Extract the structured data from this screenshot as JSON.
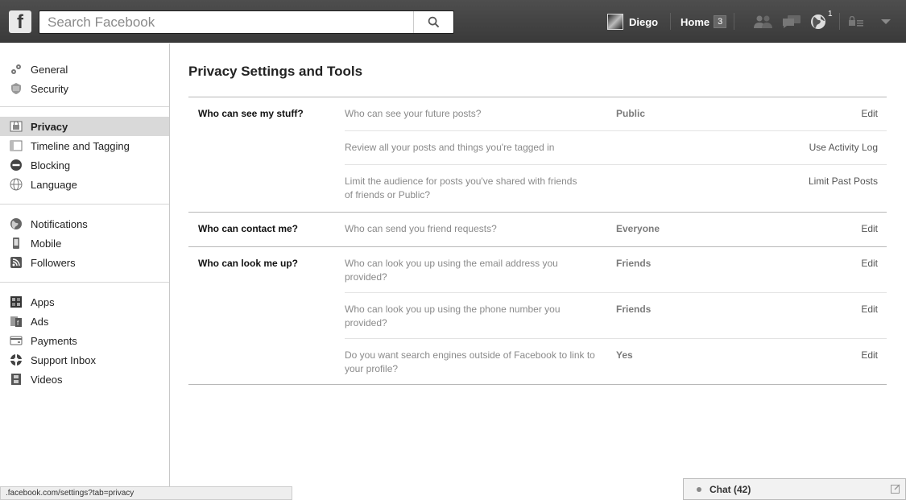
{
  "topbar": {
    "logo": "f",
    "search_placeholder": "Search Facebook",
    "user_name": "Diego",
    "home_label": "Home",
    "home_count": "3",
    "notification_count": "1"
  },
  "sidebar": {
    "group1": [
      {
        "label": "General"
      },
      {
        "label": "Security"
      }
    ],
    "group2": [
      {
        "label": "Privacy"
      },
      {
        "label": "Timeline and Tagging"
      },
      {
        "label": "Blocking"
      },
      {
        "label": "Language"
      }
    ],
    "group3": [
      {
        "label": "Notifications"
      },
      {
        "label": "Mobile"
      },
      {
        "label": "Followers"
      }
    ],
    "group4": [
      {
        "label": "Apps"
      },
      {
        "label": "Ads"
      },
      {
        "label": "Payments"
      },
      {
        "label": "Support Inbox"
      },
      {
        "label": "Videos"
      }
    ]
  },
  "main": {
    "title": "Privacy Settings and Tools",
    "sections": [
      {
        "heading": "Who can see my stuff?",
        "rows": [
          {
            "question": "Who can see your future posts?",
            "value": "Public",
            "action": "Edit"
          },
          {
            "question": "Review all your posts and things you're tagged in",
            "value": "",
            "action": "Use Activity Log"
          },
          {
            "question": "Limit the audience for posts you've shared with friends of friends or Public?",
            "value": "",
            "action": "Limit Past Posts"
          }
        ]
      },
      {
        "heading": "Who can contact me?",
        "rows": [
          {
            "question": "Who can send you friend requests?",
            "value": "Everyone",
            "action": "Edit"
          }
        ]
      },
      {
        "heading": "Who can look me up?",
        "rows": [
          {
            "question": "Who can look you up using the email address you provided?",
            "value": "Friends",
            "action": "Edit"
          },
          {
            "question": "Who can look you up using the phone number you provided?",
            "value": "Friends",
            "action": "Edit"
          },
          {
            "question": "Do you want search engines outside of Facebook to link to your profile?",
            "value": "Yes",
            "action": "Edit"
          }
        ]
      }
    ]
  },
  "status_url": ".facebook.com/settings?tab=privacy",
  "chat": {
    "label": "Chat (42)"
  }
}
